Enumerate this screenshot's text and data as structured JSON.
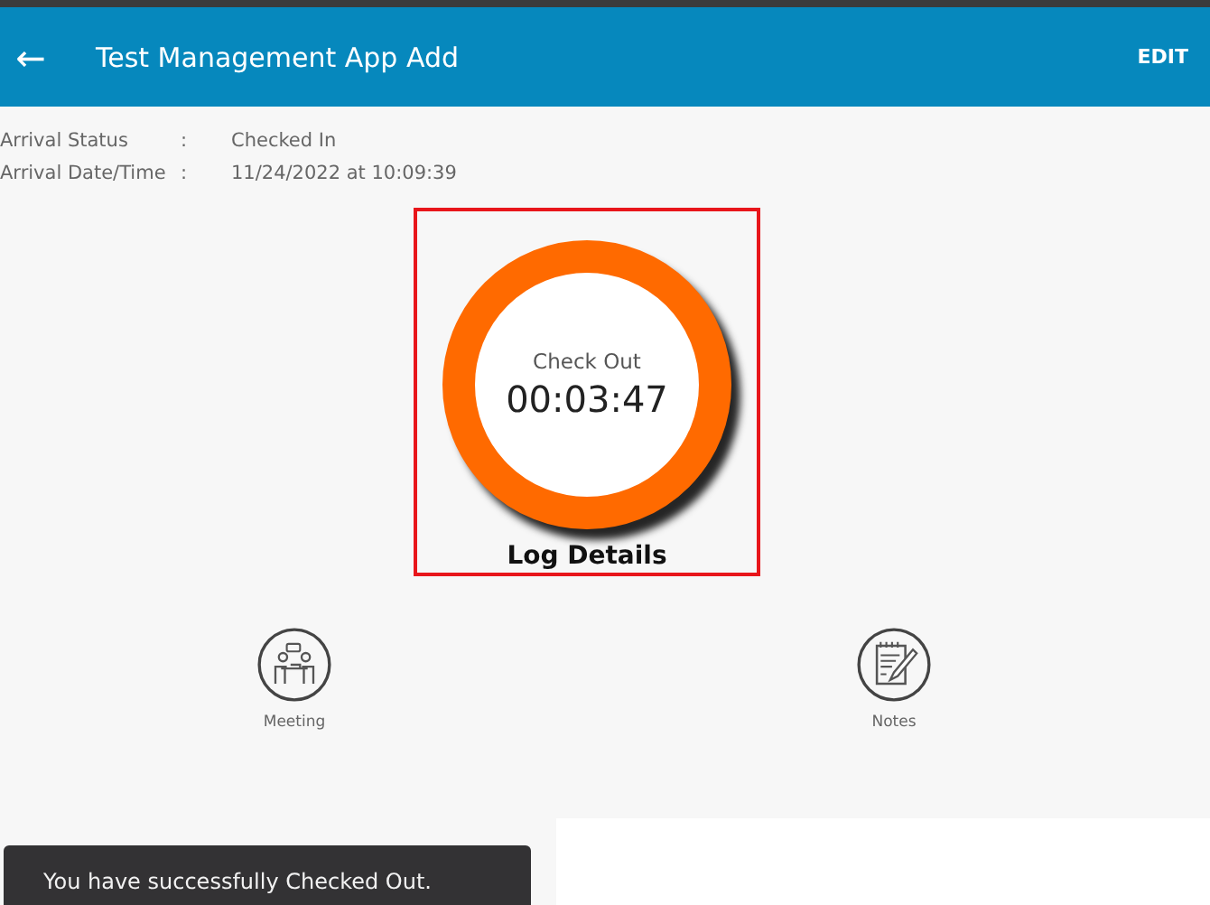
{
  "header": {
    "back_icon": "←",
    "title": "Test Management App Add",
    "action": "EDIT"
  },
  "info": [
    {
      "label": "Arrival Status",
      "separator": ":",
      "value": "Checked In"
    },
    {
      "label": "Arrival Date/Time",
      "separator": ":",
      "value": "11/24/2022 at 10:09:39"
    }
  ],
  "timer": {
    "caption": "Check Out",
    "time": "00:03:47",
    "footer": "Log Details"
  },
  "actions": [
    {
      "kind": "meeting",
      "label": "Meeting"
    },
    {
      "kind": "notes",
      "label": "Notes"
    }
  ],
  "toast": "You have successfully Checked Out."
}
